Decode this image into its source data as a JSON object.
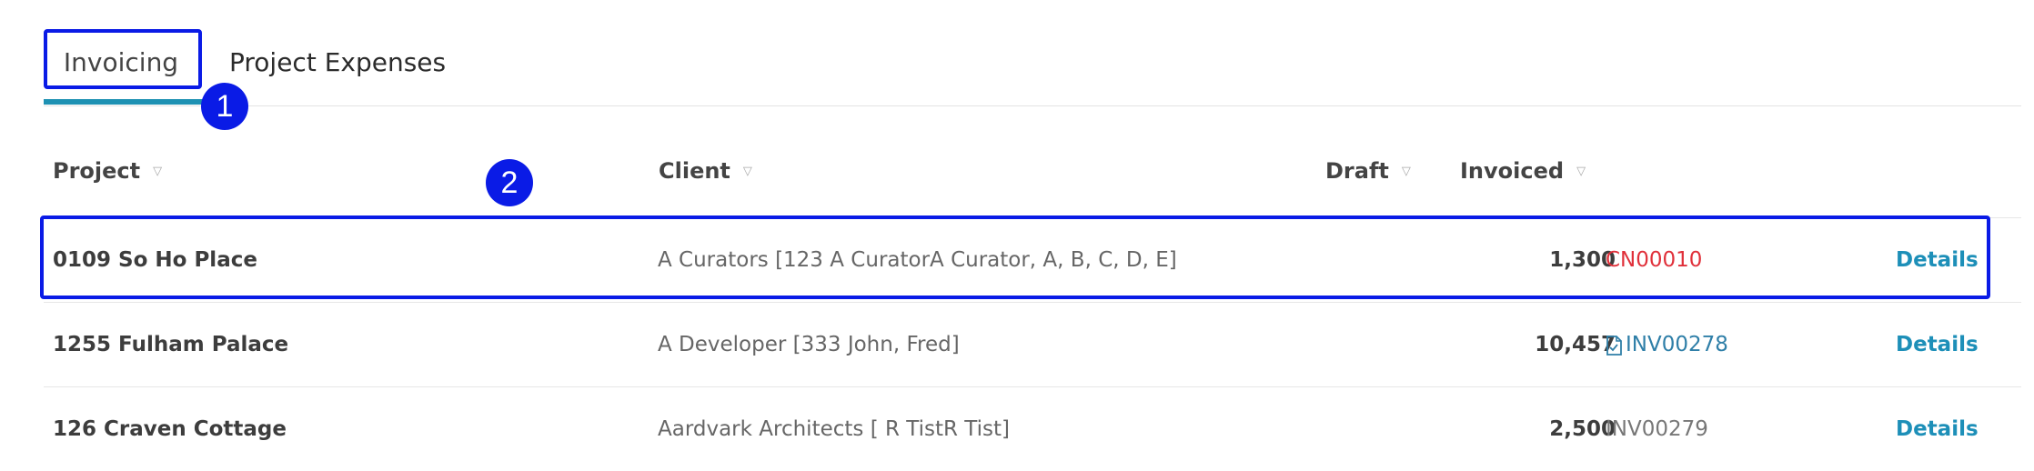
{
  "tabs": [
    {
      "label": "Invoicing",
      "active": true
    },
    {
      "label": "Project Expenses",
      "active": false
    }
  ],
  "annotations": {
    "tab_marker": "1",
    "row_marker": "2"
  },
  "table": {
    "headers": {
      "project": "Project",
      "client": "Client",
      "draft": "Draft",
      "invoiced": "Invoiced"
    },
    "rows": [
      {
        "project": "0109 So Ho Place",
        "client": "A Curators [123 A CuratorA Curator, A, B, C, D, E]",
        "amount": "1,300",
        "ref": "CN00010",
        "ref_style": "credit-note",
        "action": "Details"
      },
      {
        "project": "1255 Fulham Palace",
        "client": "A Developer [333 John, Fred]",
        "amount": "10,457",
        "ref": "INV00278",
        "ref_style": "link-with-document-icon",
        "action": "Details"
      },
      {
        "project": "126 Craven Cottage",
        "client": "Aardvark Architects [ R TistR Tist]",
        "amount": "2,500",
        "ref": "INV00279",
        "ref_style": "plain",
        "action": "Details"
      }
    ]
  },
  "colors": {
    "accent": "#1e91b3",
    "highlight": "#0a1be6",
    "credit_note": "#e0303a",
    "link": "#2f7fa8"
  }
}
